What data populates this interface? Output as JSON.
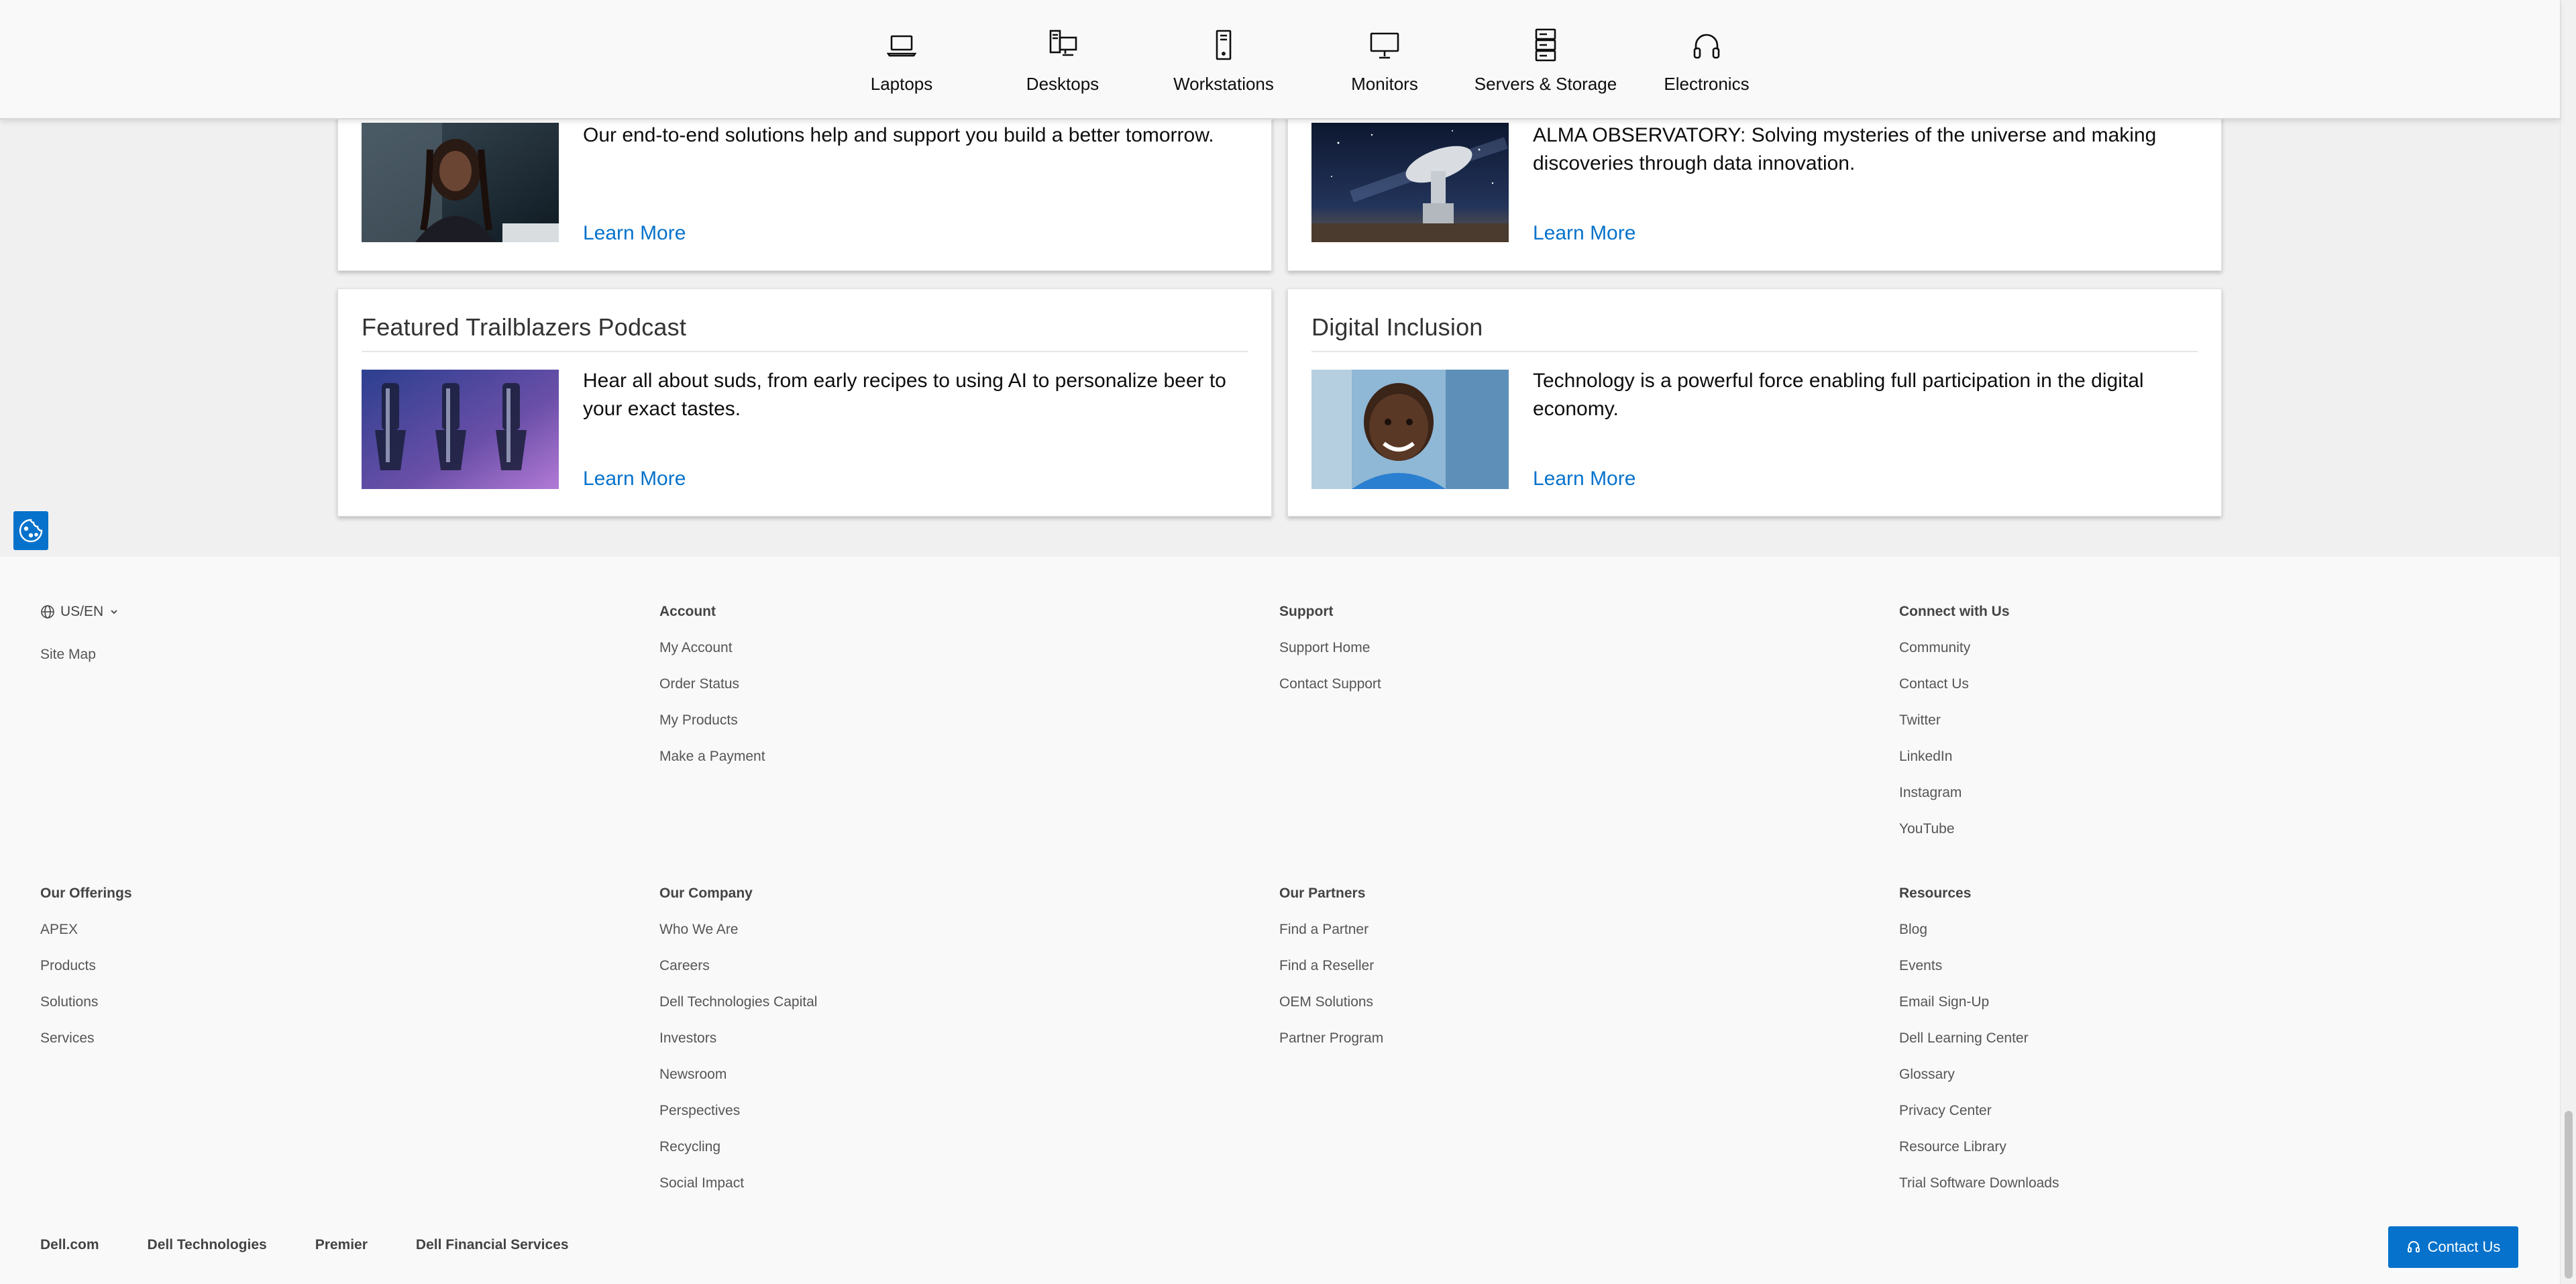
{
  "categories": [
    {
      "label": "Laptops",
      "icon": "laptop-icon"
    },
    {
      "label": "Desktops",
      "icon": "desktop-icon"
    },
    {
      "label": "Workstations",
      "icon": "workstation-icon"
    },
    {
      "label": "Monitors",
      "icon": "monitor-icon"
    },
    {
      "label": "Servers & Storage",
      "icon": "server-icon"
    },
    {
      "label": "Electronics",
      "icon": "headphones-icon"
    }
  ],
  "cards": {
    "top_left": {
      "desc": "Our end-to-end solutions help and support you build a better tomorrow.",
      "link": "Learn More"
    },
    "top_right": {
      "desc": "ALMA OBSERVATORY: Solving mysteries of the universe and making discoveries through data innovation.",
      "link": "Learn More"
    },
    "podcast": {
      "title": "Featured Trailblazers Podcast",
      "desc": "Hear all about suds, from early recipes to using AI to personalize beer to your exact tastes.",
      "link": "Learn More"
    },
    "inclusion": {
      "title": "Digital Inclusion",
      "desc": "Technology is a powerful force enabling full participation in the digital economy.",
      "link": "Learn More"
    }
  },
  "footer": {
    "locale": "US/EN",
    "site_map": "Site Map",
    "account": {
      "heading": "Account",
      "links": [
        "My Account",
        "Order Status",
        "My Products",
        "Make a Payment"
      ]
    },
    "support": {
      "heading": "Support",
      "links": [
        "Support Home",
        "Contact Support"
      ]
    },
    "connect": {
      "heading": "Connect with Us",
      "links": [
        "Community",
        "Contact Us",
        "Twitter",
        "LinkedIn",
        "Instagram",
        "YouTube"
      ]
    },
    "offerings": {
      "heading": "Our Offerings",
      "links": [
        "APEX",
        "Products",
        "Solutions",
        "Services"
      ]
    },
    "company": {
      "heading": "Our Company",
      "links": [
        "Who We Are",
        "Careers",
        "Dell Technologies Capital",
        "Investors",
        "Newsroom",
        "Perspectives",
        "Recycling",
        "Social Impact"
      ]
    },
    "partners": {
      "heading": "Our Partners",
      "links": [
        "Find a Partner",
        "Find a Reseller",
        "OEM Solutions",
        "Partner Program"
      ]
    },
    "resources": {
      "heading": "Resources",
      "links": [
        "Blog",
        "Events",
        "Email Sign-Up",
        "Dell Learning Center",
        "Glossary",
        "Privacy Center",
        "Resource Library",
        "Trial Software Downloads"
      ]
    },
    "bottom": [
      "Dell.com",
      "Dell Technologies",
      "Premier",
      "Dell Financial Services"
    ]
  },
  "contact_button": "Contact Us",
  "colors": {
    "link": "#0672cb",
    "button": "#0672cb"
  }
}
